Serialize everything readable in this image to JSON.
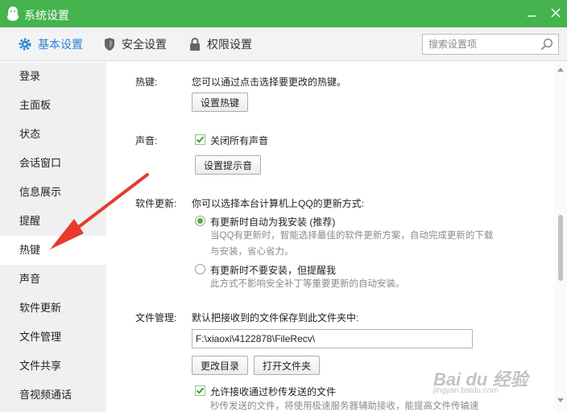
{
  "window": {
    "title": "系统设置",
    "accent_color": "#45b34e",
    "active_tab_color": "#2b84d6",
    "icons": [
      "qq-penguin-icon",
      "minimize-icon",
      "close-icon"
    ]
  },
  "toolbar": {
    "tabs": [
      {
        "label": "基本设置",
        "icon": "gear-icon",
        "active": true
      },
      {
        "label": "安全设置",
        "icon": "shield-icon",
        "active": false
      },
      {
        "label": "权限设置",
        "icon": "lock-icon",
        "active": false
      }
    ],
    "search": {
      "placeholder": "搜索设置项",
      "value": "",
      "icon": "search-icon"
    }
  },
  "sidebar": {
    "items": [
      {
        "label": "登录"
      },
      {
        "label": "主面板"
      },
      {
        "label": "状态"
      },
      {
        "label": "会话窗口"
      },
      {
        "label": "信息展示"
      },
      {
        "label": "提醒"
      },
      {
        "label": "热键",
        "active": true
      },
      {
        "label": "声音"
      },
      {
        "label": "软件更新"
      },
      {
        "label": "文件管理"
      },
      {
        "label": "文件共享"
      },
      {
        "label": "音视频通话"
      }
    ]
  },
  "hotkey": {
    "label": "热键:",
    "desc": "您可以通过点击选择要更改的热键。",
    "button": "设置热键"
  },
  "sound": {
    "label": "声音:",
    "mute_all": "关闭所有声音",
    "mute_all_checked": true,
    "button": "设置提示音"
  },
  "update": {
    "label": "软件更新:",
    "desc": "你可以选择本台计算机上QQ的更新方式:",
    "options": [
      {
        "label": "有更新时自动为我安装 (推荐)",
        "selected": true,
        "note": [
          "当QQ有更新时，智能选择最佳的软件更新方案，自动完成更新的下载",
          "与安装，省心省力。"
        ]
      },
      {
        "label": "有更新时不要安装，但提醒我",
        "selected": false,
        "note": [
          "此方式不影响安全补丁等重要更新的自动安装。"
        ]
      }
    ]
  },
  "file": {
    "label": "文件管理:",
    "desc": "默认把接收到的文件保存到此文件夹中:",
    "path": "F:\\xiaoxi\\4122878\\FileRecv\\",
    "change_button": "更改目录",
    "open_button": "打开文件夹",
    "allow_flash": "允许接收通过秒传发送的文件",
    "allow_flash_checked": true,
    "flash_note": "秒传发送的文件，将使用极速服务器辅助接收，能提高文件传输速"
  },
  "watermark": {
    "text": "Bai du 经验",
    "sub": "jingyan.baidu.com"
  },
  "annotation": {
    "arrow_color": "#e53a2f"
  }
}
